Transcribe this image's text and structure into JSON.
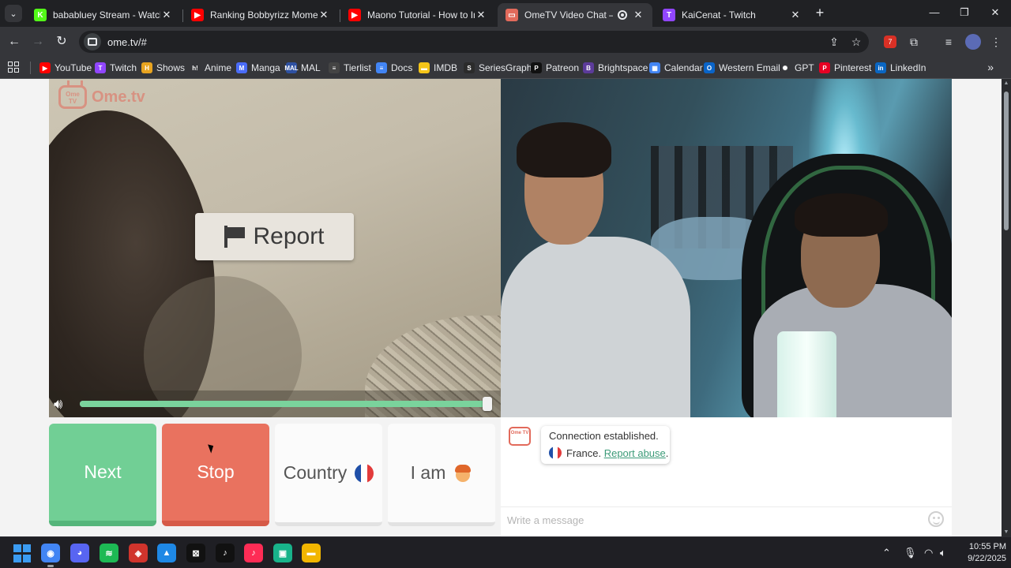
{
  "browser": {
    "tabs": [
      {
        "title": "bababluey Stream - Watch Live",
        "favicon": "kick-icon",
        "color": "#53fc18",
        "glyph": "K"
      },
      {
        "title": "Ranking Bobbyrizz Moments - YouTube",
        "favicon": "youtube-icon",
        "color": "#ff0000",
        "glyph": "▶"
      },
      {
        "title": "Maono Tutorial - How to Install",
        "favicon": "youtube-icon",
        "color": "#ff0000",
        "glyph": "▶"
      },
      {
        "title": "OmeTV Video Chat — Ome",
        "favicon": "ometv-icon",
        "color": "#e26a5b",
        "glyph": "▭",
        "active": true
      },
      {
        "title": "KaiCenat - Twitch",
        "favicon": "twitch-icon",
        "color": "#9146ff",
        "glyph": "T"
      }
    ],
    "new_tab_glyph": "+",
    "url": "ome.tv/#",
    "extensions_badge": "7",
    "bookmarks": [
      {
        "label": "YouTube",
        "icon": "youtube-icon",
        "color": "#ff0000",
        "glyph": "▶"
      },
      {
        "label": "Twitch",
        "icon": "twitch-icon",
        "color": "#9146ff",
        "glyph": "T"
      },
      {
        "label": "Shows",
        "icon": "hbo-icon",
        "color": "#e8a420",
        "glyph": "H"
      },
      {
        "label": "Anime",
        "icon": "hianime-icon",
        "color": "#35363a",
        "glyph": "h!"
      },
      {
        "label": "Manga",
        "icon": "manga-icon",
        "color": "#4a6cf7",
        "glyph": "M"
      },
      {
        "label": "MAL",
        "icon": "mal-icon",
        "color": "#2e51a2",
        "glyph": "MAL"
      },
      {
        "label": "Tierlist",
        "icon": "tierlist-icon",
        "color": "#444",
        "glyph": "≡"
      },
      {
        "label": "Docs",
        "icon": "docs-icon",
        "color": "#4285f4",
        "glyph": "≡"
      },
      {
        "label": "IMDB",
        "icon": "imdb-icon",
        "color": "#f5c518",
        "glyph": "▬"
      },
      {
        "label": "SeriesGraph",
        "icon": "seriesgraph-icon",
        "color": "#2b2b2b",
        "glyph": "S"
      },
      {
        "label": "Patreon",
        "icon": "patreon-icon",
        "color": "#111",
        "glyph": "P"
      },
      {
        "label": "Brightspace",
        "icon": "brightspace-icon",
        "color": "#5c3b9a",
        "glyph": "B"
      },
      {
        "label": "Calendar",
        "icon": "calendar-icon",
        "color": "#4285f4",
        "glyph": "▦"
      },
      {
        "label": "Western Email",
        "icon": "outlook-icon",
        "color": "#0a64c8",
        "glyph": "O"
      },
      {
        "label": "GPT",
        "icon": "chatgpt-icon",
        "color": "#35363a",
        "glyph": "✺"
      },
      {
        "label": "Pinterest",
        "icon": "pinterest-icon",
        "color": "#e60023",
        "glyph": "P"
      },
      {
        "label": "LinkedIn",
        "icon": "linkedin-icon",
        "color": "#0a66c2",
        "glyph": "in"
      }
    ]
  },
  "ometv": {
    "brand": "Ome.tv",
    "brand_badge": "Ome TV",
    "report_label": "Report",
    "volume_level": 1.0,
    "buttons": {
      "next": "Next",
      "stop": "Stop",
      "country": "Country",
      "iam": "I am"
    },
    "flag_colors": [
      "#1f4fa8",
      "#ffffff",
      "#e23b3b"
    ],
    "chat": {
      "system_line1": "Connection established.",
      "country": "France.",
      "report_abuse": "Report abuse",
      "period": ".",
      "placeholder": "Write a message"
    },
    "colors": {
      "next": "#71cf95",
      "stop": "#e9725f",
      "accent": "#e26a5b",
      "link": "#3c9b78"
    }
  },
  "taskbar": {
    "apps": [
      {
        "name": "windows-start-icon",
        "color": ""
      },
      {
        "name": "chrome-icon",
        "color": "#4285f4",
        "glyph": "◉",
        "active": true
      },
      {
        "name": "discord-icon",
        "color": "#5865f2",
        "glyph": "◕"
      },
      {
        "name": "spotify-icon",
        "color": "#1db954",
        "glyph": "≋"
      },
      {
        "name": "red-app-icon",
        "color": "#d0342c",
        "glyph": "◈"
      },
      {
        "name": "blue-app-icon",
        "color": "#1e88e5",
        "glyph": "▲"
      },
      {
        "name": "capcut-icon",
        "color": "#111",
        "glyph": "⊠"
      },
      {
        "name": "tiktok-icon",
        "color": "#111",
        "glyph": "♪"
      },
      {
        "name": "tiktok-live-icon",
        "color": "#fe2c55",
        "glyph": "♪"
      },
      {
        "name": "app-teal-icon",
        "color": "#18b38a",
        "glyph": "▣"
      },
      {
        "name": "file-explorer-icon",
        "color": "#f2b600",
        "glyph": "▬"
      }
    ],
    "time": "10:55 PM",
    "date": "9/22/2025"
  }
}
